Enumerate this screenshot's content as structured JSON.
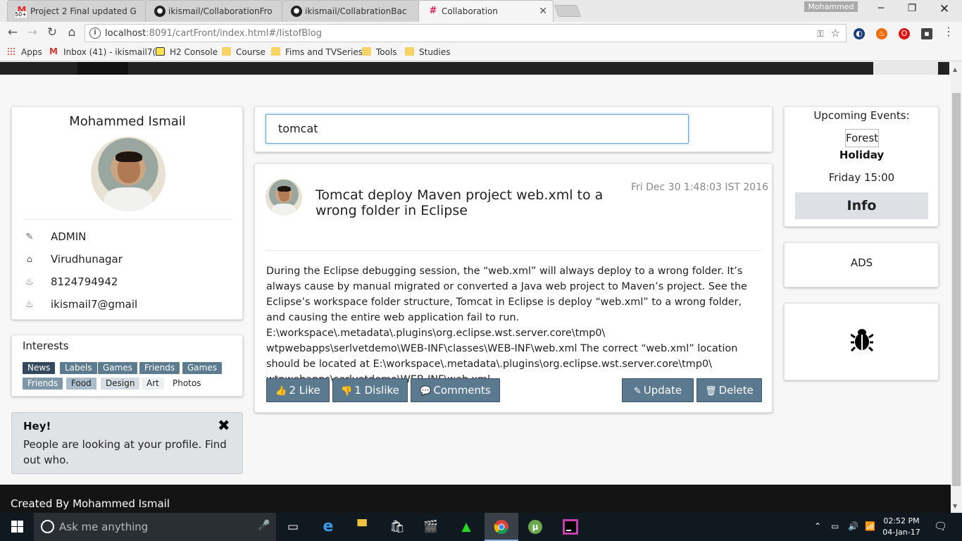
{
  "browser": {
    "tabs": [
      {
        "title": "Project 2 Final updated G",
        "favicon": "gmail-icon",
        "badge": "50+"
      },
      {
        "title": "ikismail/CollaborationFro",
        "favicon": "github-icon"
      },
      {
        "title": "ikismail/CollabrationBac",
        "favicon": "github-icon"
      },
      {
        "title": "Collaboration",
        "favicon": "slack-icon"
      }
    ],
    "profile_name": "Mohammed",
    "url_host": "localhost",
    "url_rest": ":8091/cartFront/index.html#/listofBlog",
    "bookmarks": [
      "Apps",
      "Inbox (41) - ikismail7(",
      "H2 Console",
      "Course",
      "Fims and TVSeries",
      "Tools",
      "Studies"
    ]
  },
  "profile": {
    "name": "Mohammed Ismail",
    "role": "ADMIN",
    "city": "Virudhunagar",
    "phone": "8124794942",
    "email": "ikismail7@gmail"
  },
  "interests": {
    "title": "Interests",
    "tags": [
      "News",
      "Labels",
      "Games",
      "Friends",
      "Games",
      "Friends",
      "Food",
      "Design",
      "Art",
      "Photos"
    ]
  },
  "alert": {
    "title": "Hey!",
    "close": "✖",
    "text": "People are looking at your profile. Find out who."
  },
  "search": {
    "value": "tomcat"
  },
  "blog": {
    "title": "Tomcat deploy Maven project web.xml to a wrong folder in Eclipse",
    "date": "Fri Dec 30 1:48:03 IST 2016",
    "body": "During the Eclipse debugging session, the “web.xml” will always deploy to a wrong folder. It’s always cause by manual migrated or converted a Java web project to Maven’s project. See the Eclipse’s workspace folder structure, Tomcat in Eclipse is deploy “web.xml” to a wrong folder, and causing the entire web application fail to run. E:\\workspace\\.metadata\\.plugins\\org.eclipse.wst.server.core\\tmp0\\ wtpwebapps\\serlvetdemo\\WEB-INF\\classes\\WEB-INF\\web.xml The correct “web.xml” location should be located at E:\\workspace\\.metadata\\.plugins\\org.eclipse.wst.server.core\\tmp0\\ wtpwebapps\\serlvetdemo\\WEB-INF\\web.xml.",
    "like_label": "2 Like",
    "dislike_label": "1 Dislike",
    "comments_label": "Comments",
    "update_label": "Update",
    "delete_label": "Delete"
  },
  "events": {
    "title": "Upcoming Events:",
    "name": "Forest",
    "type": "Holiday",
    "time": "Friday 15:00",
    "info_label": "Info"
  },
  "ads": {
    "label": "ADS"
  },
  "footer": {
    "text": "Created By Mohammed Ismail"
  },
  "taskbar": {
    "search_placeholder": "Ask me anything",
    "time": "02:52 PM",
    "date": "04-Jan-17"
  },
  "colors": {
    "button_bg": "#5c7a8f",
    "tag_dark": "#34495e",
    "tag_mid": "#5d7b8f",
    "tag_light": "#a9bccb",
    "alert_bg": "#dfe3e6",
    "footer_bg": "#141414"
  }
}
